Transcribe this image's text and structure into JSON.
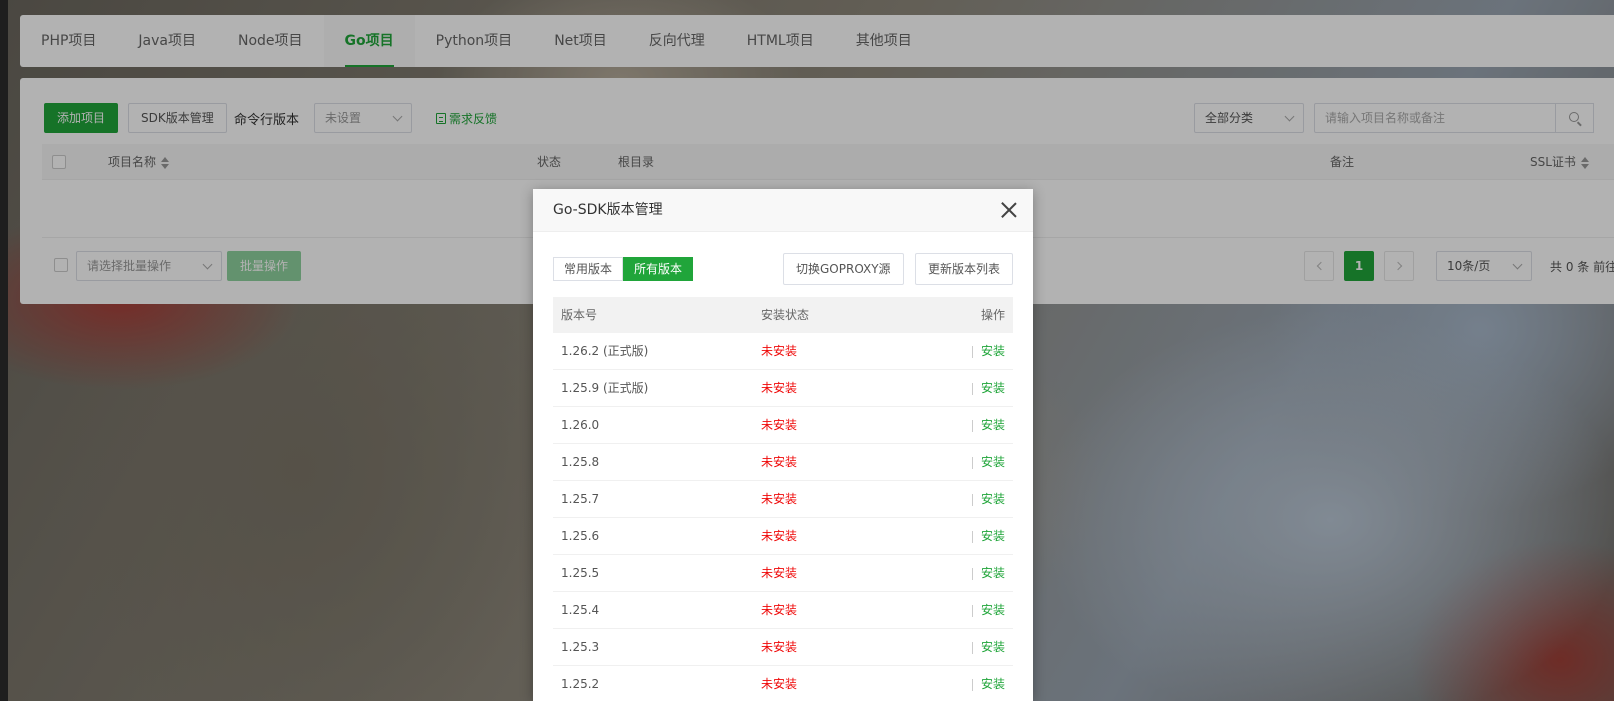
{
  "tabs": [
    {
      "label": "PHP项目"
    },
    {
      "label": "Java项目"
    },
    {
      "label": "Node项目"
    },
    {
      "label": "Go项目"
    },
    {
      "label": "Python项目"
    },
    {
      "label": "Net项目"
    },
    {
      "label": "反向代理"
    },
    {
      "label": "HTML项目"
    },
    {
      "label": "其他项目"
    }
  ],
  "active_tab_index": 3,
  "toolbar": {
    "add_project": "添加项目",
    "sdk_manage": "SDK版本管理",
    "cli_version_label": "命令行版本",
    "cli_version_value": "未设置",
    "feedback": "需求反馈",
    "category_select": "全部分类",
    "search_placeholder": "请输入项目名称或备注"
  },
  "table": {
    "columns": {
      "name": "项目名称",
      "status": "状态",
      "root": "根目录",
      "remark": "备注",
      "ssl": "SSL证书"
    }
  },
  "footer": {
    "batch_select": "请选择批量操作",
    "batch_button": "批量操作",
    "current_page": "1",
    "page_size": "10条/页",
    "total": "共 0 条  前往"
  },
  "modal": {
    "title": "Go-SDK版本管理",
    "segments": {
      "common": "常用版本",
      "all": "所有版本"
    },
    "active_segment": "all",
    "switch_proxy": "切换GOPROXY源",
    "update_list": "更新版本列表",
    "columns": {
      "version": "版本号",
      "status": "安装状态",
      "action": "操作"
    },
    "rows": [
      {
        "version": "1.26.2 (正式版)",
        "status": "未安装",
        "action": "安装"
      },
      {
        "version": "1.25.9 (正式版)",
        "status": "未安装",
        "action": "安装"
      },
      {
        "version": "1.26.0",
        "status": "未安装",
        "action": "安装"
      },
      {
        "version": "1.25.8",
        "status": "未安装",
        "action": "安装"
      },
      {
        "version": "1.25.7",
        "status": "未安装",
        "action": "安装"
      },
      {
        "version": "1.25.6",
        "status": "未安装",
        "action": "安装"
      },
      {
        "version": "1.25.5",
        "status": "未安装",
        "action": "安装"
      },
      {
        "version": "1.25.4",
        "status": "未安装",
        "action": "安装"
      },
      {
        "version": "1.25.3",
        "status": "未安装",
        "action": "安装"
      },
      {
        "version": "1.25.2",
        "status": "未安装",
        "action": "安装"
      }
    ]
  },
  "colors": {
    "accent": "#20a53a",
    "danger": "#ef0808"
  }
}
